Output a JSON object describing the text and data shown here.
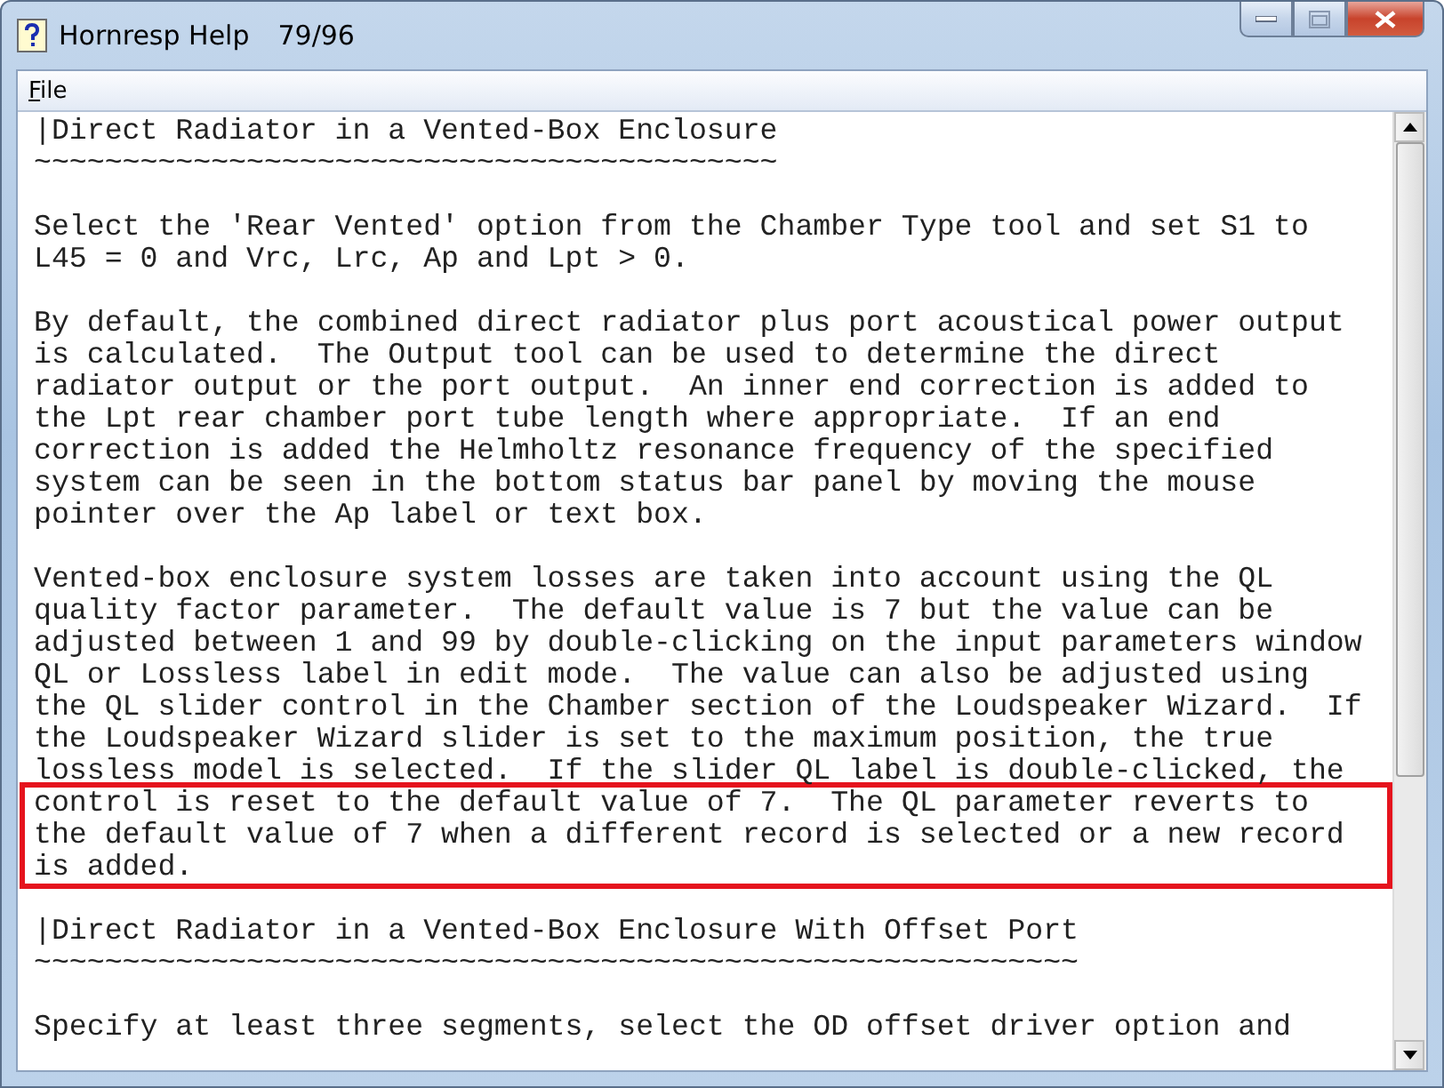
{
  "window": {
    "title": "Hornresp Help",
    "page": "79/96"
  },
  "menu": [
    {
      "label": "File"
    }
  ],
  "blocks": [
    {
      "kind": "heading",
      "lines": [
        "|Direct Radiator in a Vented-Box Enclosure"
      ],
      "highlighted": false
    },
    {
      "kind": "rule",
      "lines": [
        "~~~~~~~~~~~~~~~~~~~~~~~~~~~~~~~~~~~~~~~~~~"
      ],
      "highlighted": false
    },
    {
      "kind": "blank"
    },
    {
      "kind": "text",
      "lines": [
        "Select the 'Rear Vented' option from the Chamber Type tool and set S1 to",
        "L45 = 0 and Vrc, Lrc, Ap and Lpt > 0."
      ],
      "highlighted": false
    },
    {
      "kind": "blank"
    },
    {
      "kind": "text",
      "lines": [
        "By default, the combined direct radiator plus port acoustical power output",
        "is calculated.  The Output tool can be used to determine the direct",
        "radiator output or the port output.  An inner end correction is added to",
        "the Lpt rear chamber port tube length where appropriate.  If an end",
        "correction is added the Helmholtz resonance frequency of the specified",
        "system can be seen in the bottom status bar panel by moving the mouse",
        "pointer over the Ap label or text box."
      ],
      "highlighted": false
    },
    {
      "kind": "blank"
    },
    {
      "kind": "text",
      "lines": [
        "Vented-box enclosure system losses are taken into account using the QL",
        "quality factor parameter.  The default value is 7 but the value can be",
        "adjusted between 1 and 99 by double-clicking on the input parameters window",
        "QL or Lossless label in edit mode.  The value can also be adjusted using",
        "the QL slider control in the Chamber section of the Loudspeaker Wizard.  If",
        "the Loudspeaker Wizard slider is set to the maximum position, the true",
        "lossless model is selected.  If the slider QL label is double-clicked, the"
      ],
      "highlighted": false
    },
    {
      "kind": "text",
      "lines": [
        "control is reset to the default value of 7.  The QL parameter reverts to",
        "the default value of 7 when a different record is selected or a new record",
        "is added."
      ],
      "highlighted": true
    },
    {
      "kind": "blank"
    },
    {
      "kind": "heading",
      "lines": [
        "|Direct Radiator in a Vented-Box Enclosure With Offset Port"
      ],
      "highlighted": false
    },
    {
      "kind": "rule",
      "lines": [
        "~~~~~~~~~~~~~~~~~~~~~~~~~~~~~~~~~~~~~~~~~~~~~~~~~~~~~~~~~~~"
      ],
      "highlighted": false
    },
    {
      "kind": "blank"
    },
    {
      "kind": "text",
      "lines": [
        "Specify at least three segments, select the OD offset driver option and"
      ],
      "highlighted": false
    }
  ]
}
